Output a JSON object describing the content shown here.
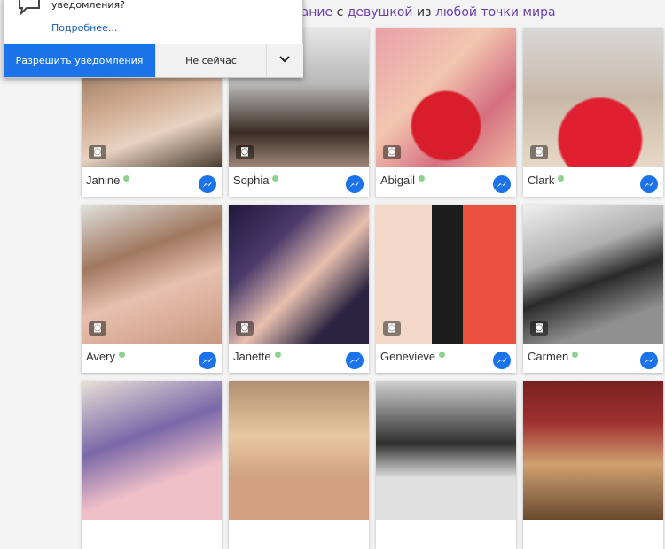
{
  "headline": {
    "part1": "дание",
    "part2": "с",
    "part3": "девушкой",
    "part4": "из",
    "part5": "любой точки мира"
  },
  "popup": {
    "question": "уведомления?",
    "more_link": "Подробнее...",
    "allow_label": "Разрешить уведомления",
    "not_now_label": "Не сейчас"
  },
  "profiles": [
    {
      "name": "Janine"
    },
    {
      "name": "Sophia"
    },
    {
      "name": "Abigail"
    },
    {
      "name": "Clark"
    },
    {
      "name": "Avery"
    },
    {
      "name": "Janette"
    },
    {
      "name": "Genevieve"
    },
    {
      "name": "Carmen"
    },
    {
      "name": ""
    },
    {
      "name": ""
    },
    {
      "name": ""
    },
    {
      "name": ""
    }
  ],
  "colors": {
    "accent": "#1a73e8",
    "headline_highlight": "#6a3fb0",
    "online_dot": "#8fd18f"
  }
}
